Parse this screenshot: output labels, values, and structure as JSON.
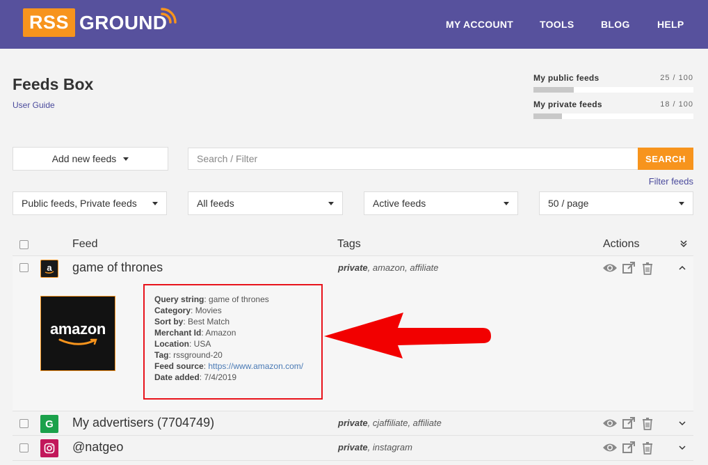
{
  "header": {
    "logo_rss": "RSS",
    "logo_ground": "GROUND",
    "brand_color": "#57519d",
    "accent_color": "#f7941d",
    "nav": [
      "MY ACCOUNT",
      "TOOLS",
      "BLOG",
      "HELP"
    ]
  },
  "page": {
    "title": "Feeds Box",
    "user_guide": "User Guide"
  },
  "quotas": [
    {
      "label": "My public feeds",
      "count": "25 / 100",
      "fraction": 0.25
    },
    {
      "label": "My private feeds",
      "count": "18 / 100",
      "fraction": 0.18
    }
  ],
  "controls": {
    "add_label": "Add new feeds",
    "search_placeholder": "Search / Filter",
    "search_button": "SEARCH",
    "filter_link": "Filter feeds",
    "selects": [
      "Public feeds, Private feeds",
      "All feeds",
      "Active feeds",
      "50 / page"
    ]
  },
  "table": {
    "headers": {
      "feed": "Feed",
      "tags": "Tags",
      "actions": "Actions"
    },
    "rows": [
      {
        "title": "game of thrones",
        "icon": "amazon-icon",
        "tag_first": "private",
        "tag_rest": ", amazon, affiliate",
        "expanded": true,
        "thumb_word": "amazon",
        "details": [
          {
            "label": "Query string",
            "value": "game of thrones"
          },
          {
            "label": "Category",
            "value": "Movies"
          },
          {
            "label": "Sort by",
            "value": "Best Match"
          },
          {
            "label": "Merchant Id",
            "value": "Amazon"
          },
          {
            "label": "Location",
            "value": "USA"
          },
          {
            "label": "Tag",
            "value": "rssground-20"
          },
          {
            "label": "Feed source",
            "value": "https://www.amazon.com/"
          },
          {
            "label": "Date added",
            "value": "7/4/2019"
          }
        ]
      },
      {
        "title": "My advertisers (7704749)",
        "icon": "cj-affiliate-icon",
        "tag_first": "private",
        "tag_rest": ", cjaffiliate, affiliate",
        "expanded": false
      },
      {
        "title": "@natgeo",
        "icon": "instagram-icon",
        "tag_first": "private",
        "tag_rest": ", instagram",
        "expanded": false
      }
    ]
  }
}
